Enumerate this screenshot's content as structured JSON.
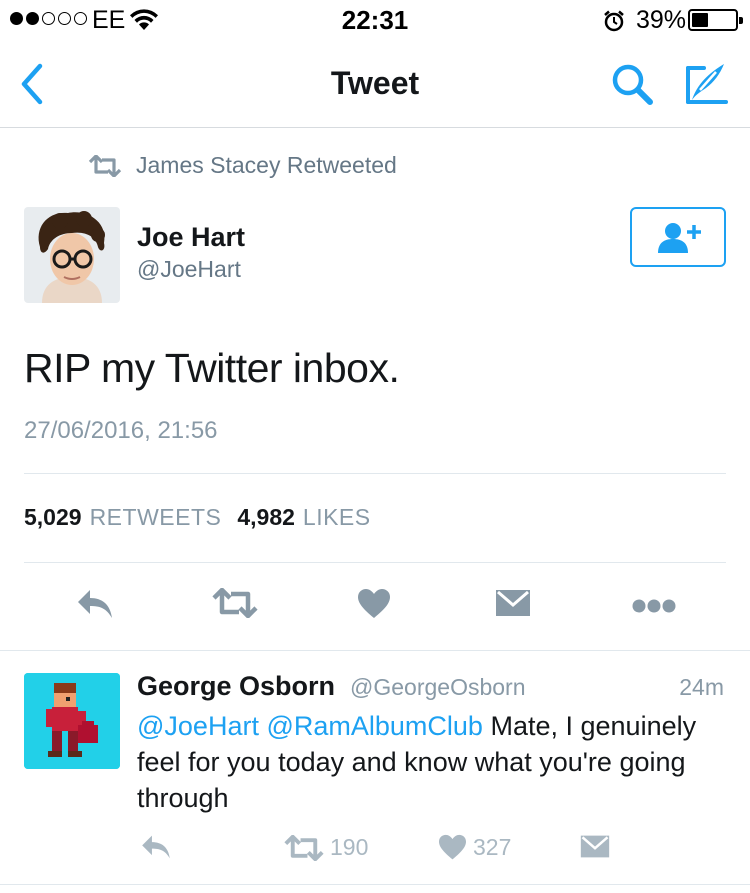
{
  "status_bar": {
    "carrier": "EE",
    "time": "22:31",
    "battery_percent": "39%",
    "signal_bars_filled": 2,
    "signal_bars_total": 5,
    "battery_level": 0.39
  },
  "nav": {
    "title": "Tweet",
    "back_icon": "chevron-left-icon",
    "search_icon": "search-icon",
    "compose_icon": "compose-icon",
    "accent_color": "#1da1f2"
  },
  "tweet": {
    "retweet_context": "James Stacey Retweeted",
    "author_name": "Joe Hart",
    "author_handle": "@JoeHart",
    "text": "RIP my Twitter inbox.",
    "date": "27/06/2016, 21:56",
    "retweets_count": "5,029",
    "retweets_label": "RETWEETS",
    "likes_count": "4,982",
    "likes_label": "LIKES",
    "follow_icon": "add-user-icon"
  },
  "reply": {
    "author_name": "George Osborn",
    "author_handle": "@GeorgeOsborn",
    "time": "24m",
    "mention1": "@JoeHart",
    "mention2": "@RamAlbumClub",
    "text": "Mate, I genuinely feel for you today and know what you're going through",
    "retweets": "190",
    "likes": "327"
  }
}
